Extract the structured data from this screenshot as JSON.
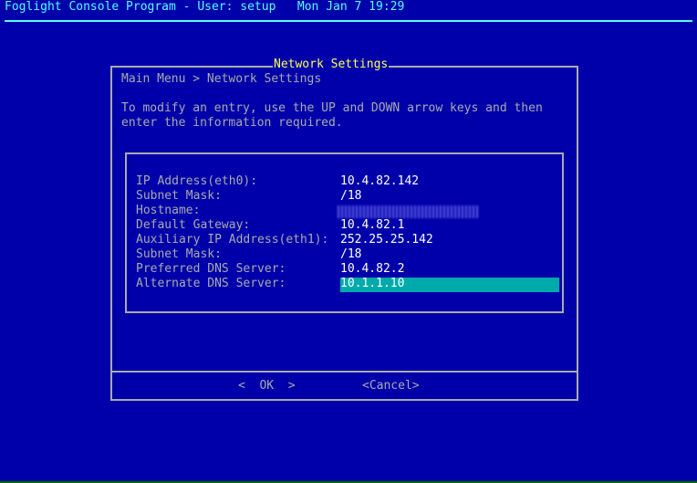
{
  "header": {
    "title": "Foglight Console Program - User: setup   Mon Jan 7 19:29"
  },
  "dialog": {
    "title": "Network Settings",
    "breadcrumb": "Main Menu > Network Settings",
    "instructions_1": "To modify an entry, use the UP and DOWN arrow keys and then",
    "instructions_2": "enter the information required.",
    "fields": [
      {
        "label": "IP Address(eth0):",
        "value": "10.4.82.142"
      },
      {
        "label": "Subnet Mask:",
        "value": "/18"
      },
      {
        "label": "Hostname:",
        "value": ""
      },
      {
        "label": "Default Gateway:",
        "value": "10.4.82.1"
      },
      {
        "label": "Auxiliary IP Address(eth1):",
        "value": "252.25.25.142"
      },
      {
        "label": "Subnet Mask:",
        "value": "/18"
      },
      {
        "label": "Preferred DNS Server:",
        "value": "10.4.82.2"
      },
      {
        "label": "Alternate DNS Server:",
        "value": "10.1.1.10"
      }
    ],
    "ok_label": "<  OK  >",
    "cancel_label": "<Cancel>"
  },
  "colors": {
    "background": "#0000aa",
    "title": "#55ffff",
    "dialog_title": "#ffff55",
    "highlight": "#00aaaa"
  }
}
